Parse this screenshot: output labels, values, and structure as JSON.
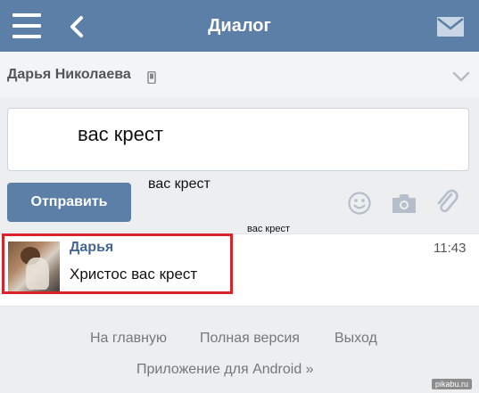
{
  "header": {
    "title": "Диалог"
  },
  "peer": {
    "name": "Дарья Николаева"
  },
  "composer": {
    "input_value": "вас крест",
    "send_label": "Отправить"
  },
  "overlays": {
    "text_a": "вас крест",
    "text_b": "вас крест"
  },
  "message": {
    "sender": "Дарья",
    "text": "Христос вас крест",
    "time": "11:43"
  },
  "footer": {
    "home": "На главную",
    "full_version": "Полная версия",
    "logout": "Выход",
    "android_app": "Приложение для Android »"
  },
  "watermark": "pikabu.ru",
  "colors": {
    "accent": "#5b7fa6",
    "highlight": "#d8232a",
    "name_link": "#45678f"
  }
}
